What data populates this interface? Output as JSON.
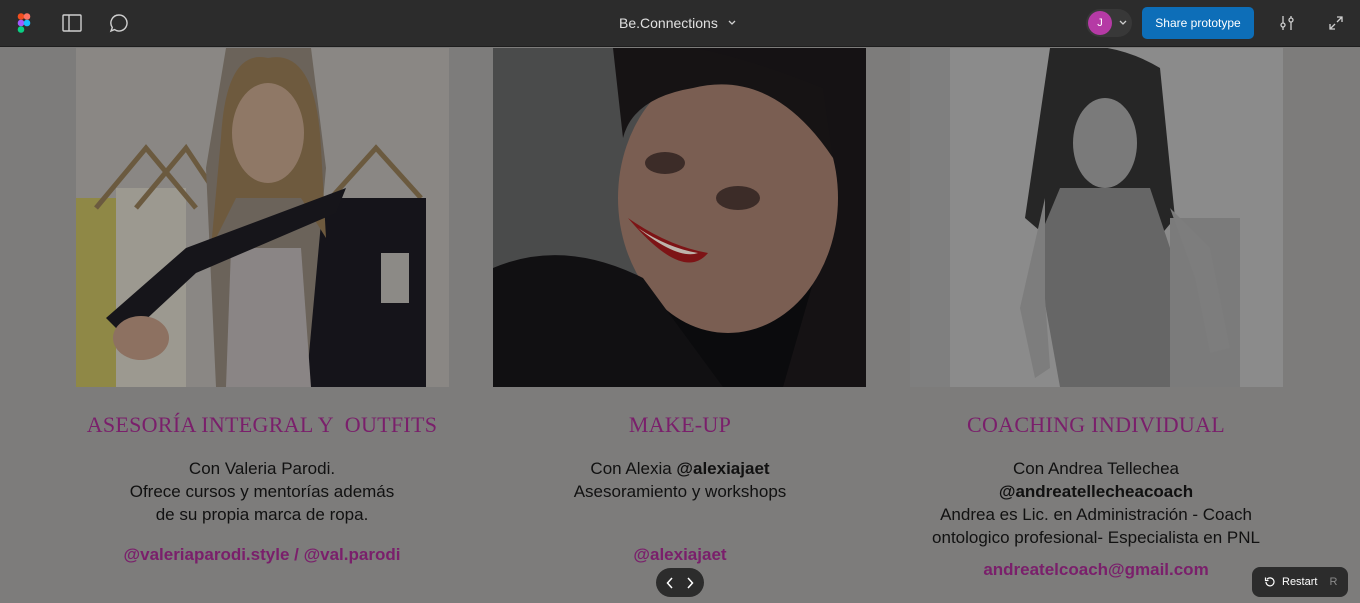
{
  "toolbar": {
    "logo_icon": "figma-logo-icon",
    "panel_icon": "sidebar-panel-icon",
    "comment_icon": "comment-icon",
    "title": "Be.Connections",
    "title_chevron": "⌄",
    "avatar_initial": "J",
    "avatar_color": "#b53aa5",
    "share_label": "Share prototype",
    "settings_icon": "sliders-icon",
    "fullscreen_icon": "expand-icon"
  },
  "cards": [
    {
      "title": "ASESORÍA INTEGRAL Y  OUTFITS",
      "lines": [
        "Con Valeria Parodi.",
        "Ofrece cursos y mentorías además",
        "de su propia marca de ropa."
      ],
      "link": "@valeriaparodi.style / @val.parodi"
    },
    {
      "title": "MAKE-UP",
      "line1_prefix": "Con Alexia ",
      "line1_handle": "@alexiajaet",
      "line2": "Asesoramiento y workshops",
      "link": "@alexiajaet"
    },
    {
      "title": "COACHING INDIVIDUAL",
      "line1": "Con Andrea Tellechea",
      "handle": "@andreatellecheacoach",
      "line3": "Andrea es Lic. en Administración - Coach",
      "line4": "ontologico profesional- Especialista en PNL",
      "link": "andreatelcoach@gmail.com"
    }
  ],
  "controls": {
    "prev_icon": "‹",
    "next_icon": "›",
    "restart_label": "Restart",
    "restart_key": "R"
  },
  "colors": {
    "accent": "#7a1f6b",
    "share_button": "#0d6eb8",
    "overlay_bg": "#7d7c7b"
  }
}
